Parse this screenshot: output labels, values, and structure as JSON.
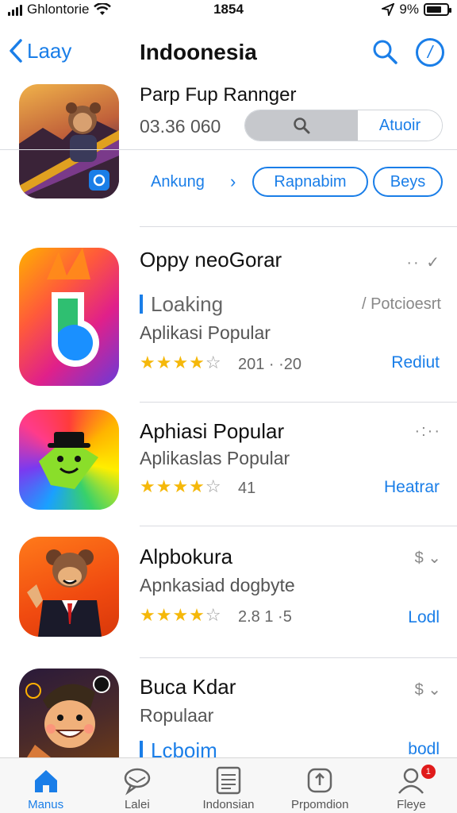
{
  "status_bar": {
    "carrier": "Ghlontorie",
    "time": "1854",
    "battery": "9%"
  },
  "nav": {
    "back_label": "Laay",
    "title": "Indoonesia"
  },
  "featured": {
    "title": "Parp Fup Rannger",
    "price": "03.36 060",
    "action_label": "Atuoir",
    "link_label": "Ankung",
    "pill_1": "Rapnabim",
    "pill_2": "Beys"
  },
  "apps": [
    {
      "title": "Oppy neoGorar",
      "subtitle_1": "Loaking",
      "side_text": "/ Potcioesrt",
      "subtitle_2": "Aplikasi Popular",
      "rating": 4,
      "count": "201 · ·20",
      "action": "Rediut"
    },
    {
      "title": "Aphiasi Popular",
      "subtitle_1": "Aplikaslas Popular",
      "rating": 4,
      "count": "41",
      "action": "Heatrar"
    },
    {
      "title": "Alpbokura",
      "subtitle_1": "Apnkasiad dogbyte",
      "rating": 4,
      "count": "2.8 1 ·5",
      "action": "Lodl"
    },
    {
      "title": "Buca Kdar",
      "subtitle_1": "Ropulaar",
      "subtitle_2": "Lcboim",
      "action": "bodl"
    }
  ],
  "tabs": [
    {
      "label": "Manus",
      "icon": "house-icon"
    },
    {
      "label": "Lalei",
      "icon": "chat-icon"
    },
    {
      "label": "Indonsian",
      "icon": "list-icon"
    },
    {
      "label": "Prpomdion",
      "icon": "update-icon"
    },
    {
      "label": "Fleye",
      "icon": "person-icon",
      "badge": "1"
    }
  ],
  "colors": {
    "accent": "#1a7ee8",
    "star": "#f5b80a",
    "badge": "#e01b1b"
  }
}
